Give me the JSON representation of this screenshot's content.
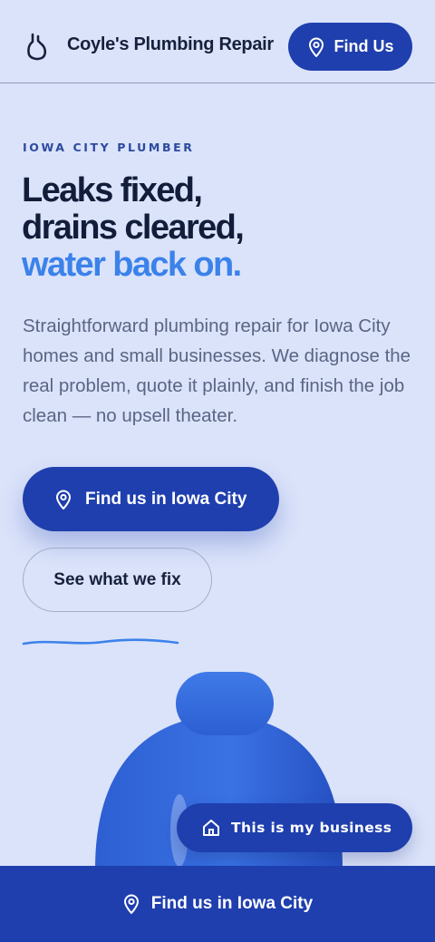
{
  "header": {
    "brand": "Coyle's Plumbing Repair",
    "logo_icon": "drop-icon",
    "find_us_label": "Find Us"
  },
  "hero": {
    "eyebrow": "IOWA CITY PLUMBER",
    "headline_line1": "Leaks fixed,",
    "headline_line2": "drains cleared,",
    "headline_accent": "water back on.",
    "lede": "Straightforward plumbing repair for Iowa City homes and small businesses. We diagnose the real problem, quote it plainly, and finish the job clean — no upsell theater.",
    "primary_cta": "Find us in Iowa City",
    "secondary_cta": "See what we fix"
  },
  "floating": {
    "business_label": "This is my business",
    "business_icon": "home-icon"
  },
  "bottom_bar": {
    "label": "Find us in Iowa City",
    "icon": "map-pin-icon"
  },
  "colors": {
    "background": "#dbe3fa",
    "primary": "#1f3fae",
    "accent": "#3b82ea",
    "heading": "#121d3a",
    "body_text": "#596684"
  }
}
